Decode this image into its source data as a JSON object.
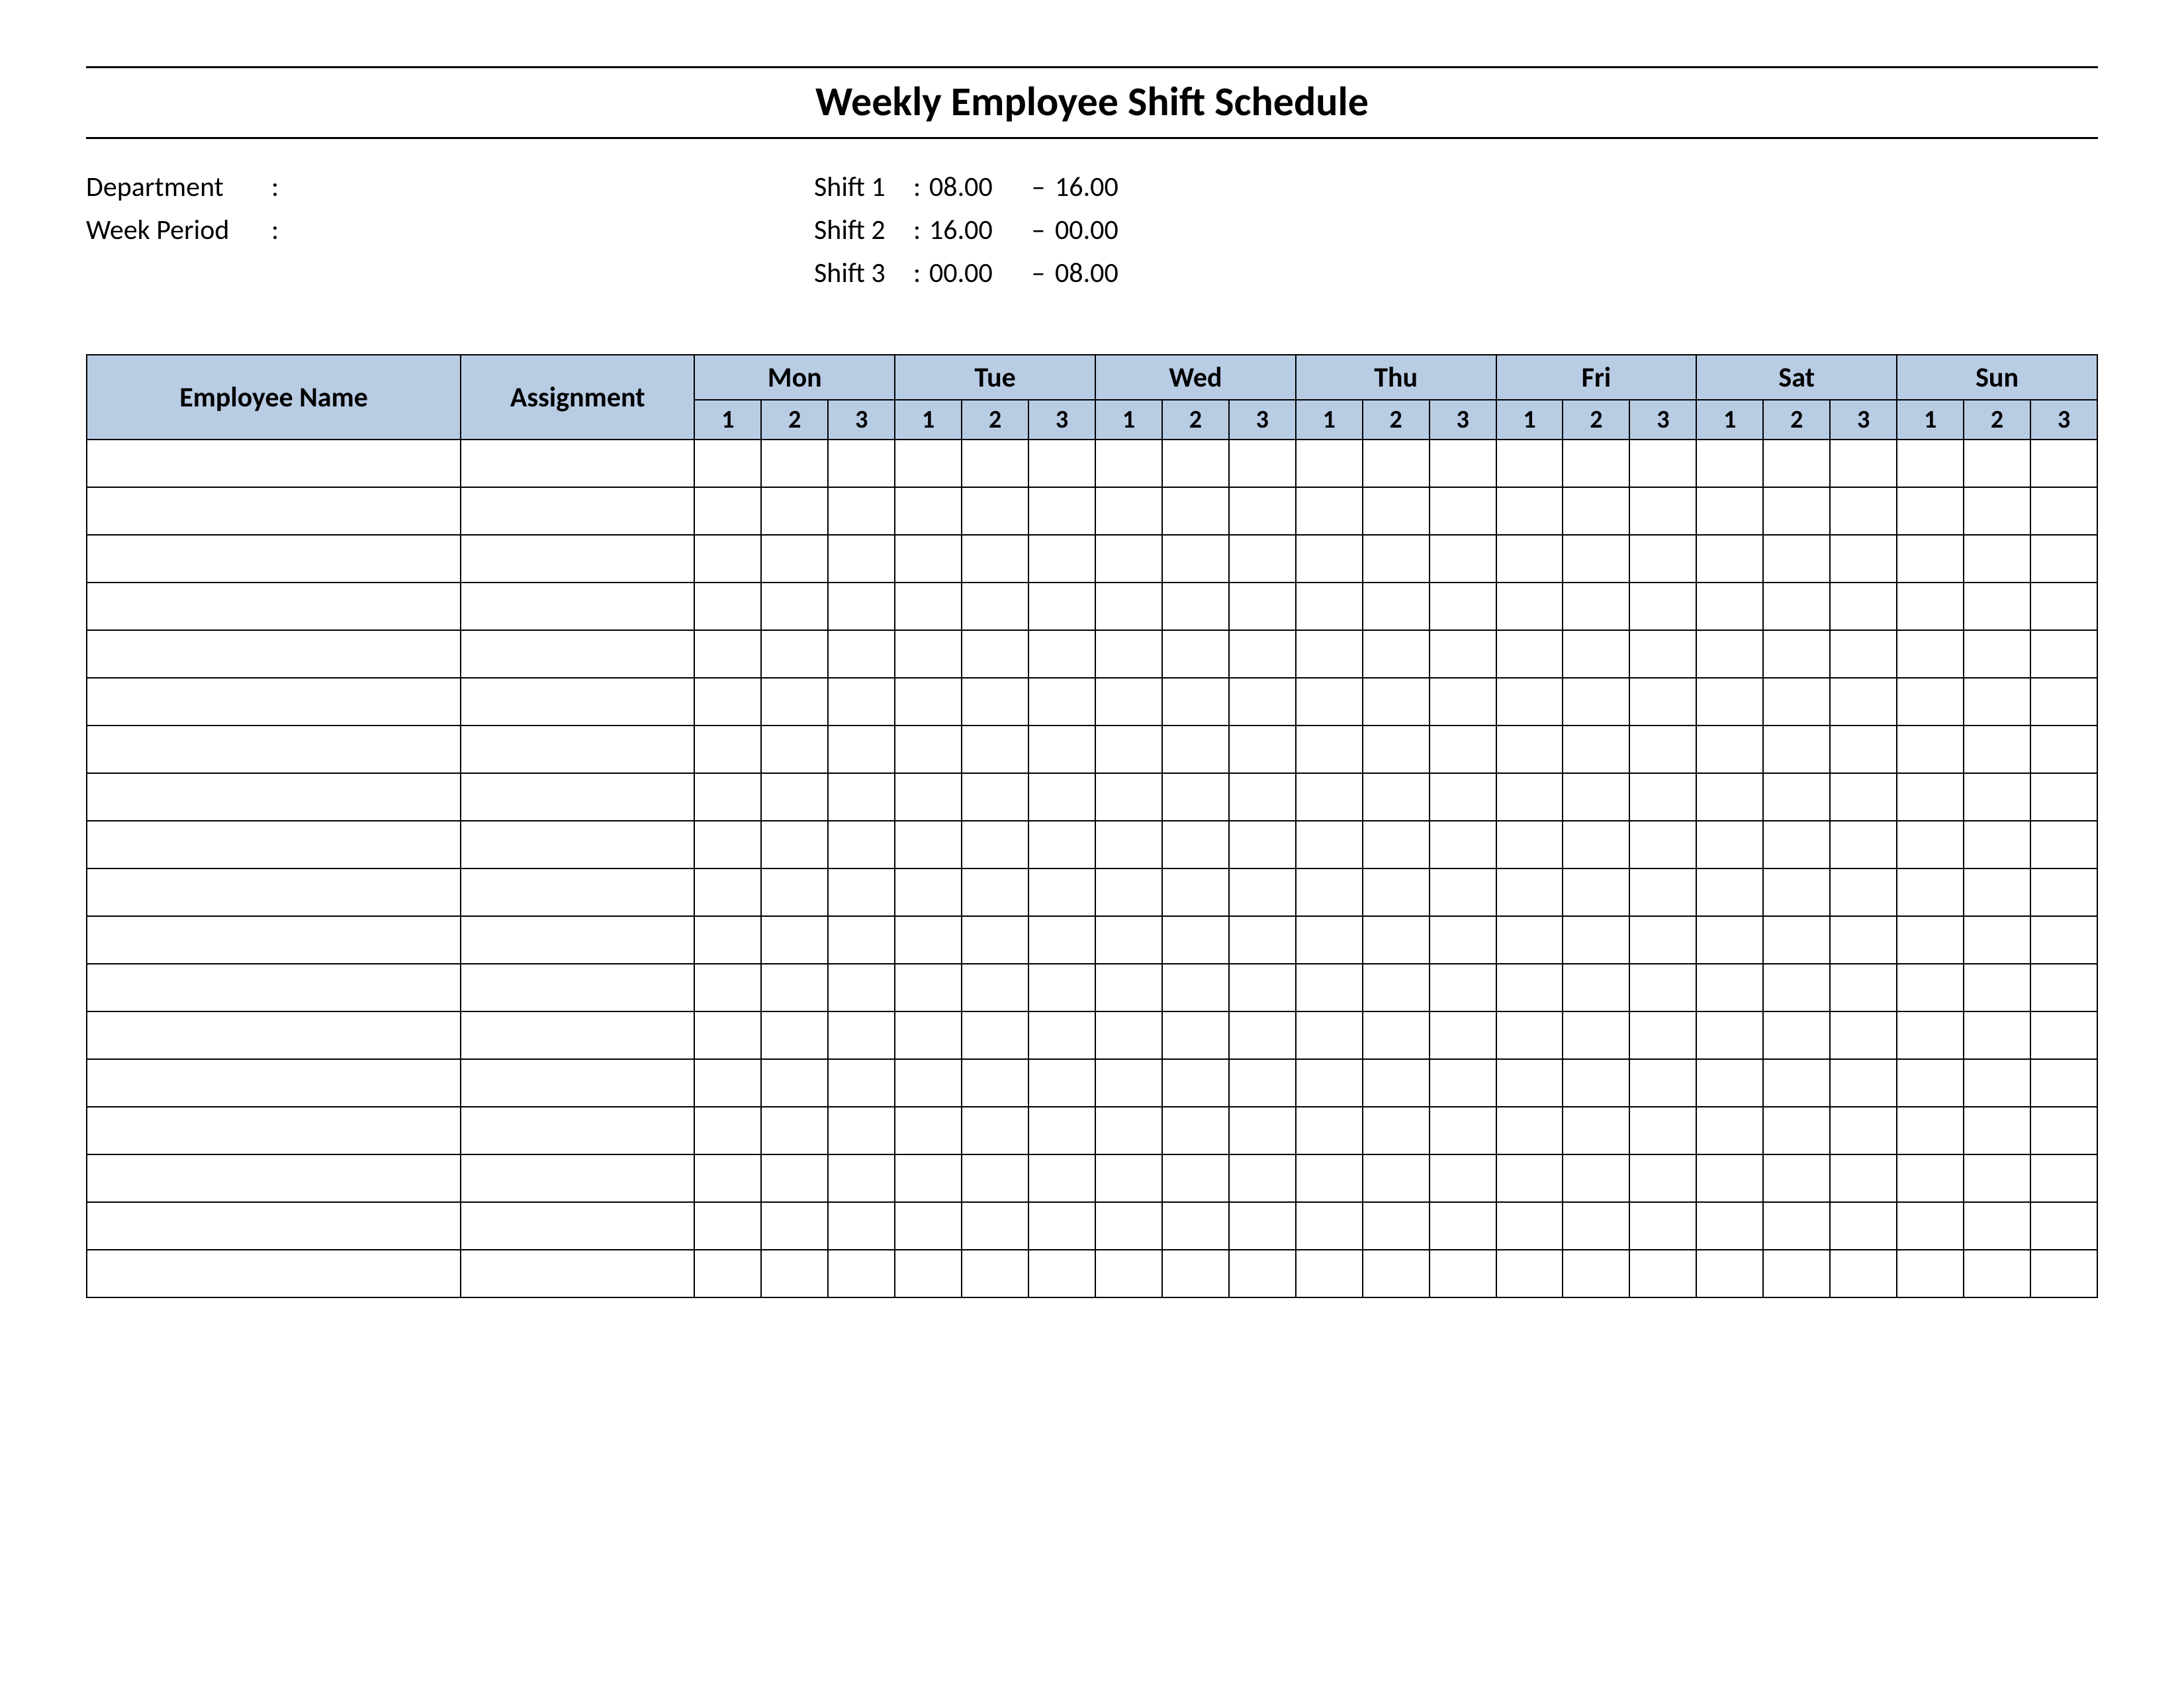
{
  "title": "Weekly Employee Shift Schedule",
  "meta": {
    "department_label": "Department",
    "week_period_label": "Week Period",
    "department_value": "",
    "week_period_value": ""
  },
  "shifts": [
    {
      "label": "Shift 1",
      "start": "08.00",
      "end": "16.00"
    },
    {
      "label": "Shift 2",
      "start": "16.00",
      "end": "00.00"
    },
    {
      "label": "Shift 3",
      "start": "00.00",
      "end": "08.00"
    }
  ],
  "table": {
    "employee_name_header": "Employee Name",
    "assignment_header": "Assignment",
    "days": [
      "Mon",
      "Tue",
      "Wed",
      "Thu",
      "Fri",
      "Sat",
      "Sun"
    ],
    "sub_shifts": [
      "1",
      "2",
      "3"
    ],
    "row_count": 18
  }
}
